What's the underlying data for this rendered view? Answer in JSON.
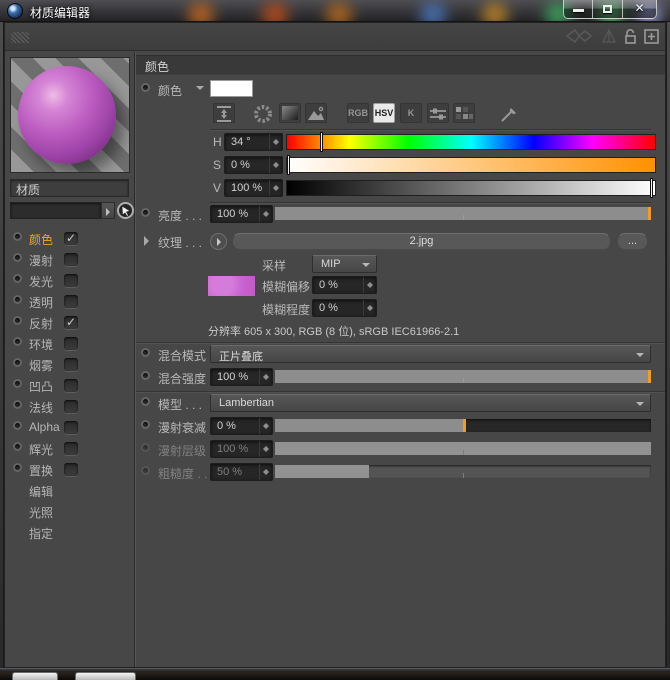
{
  "window": {
    "title": "材质编辑器"
  },
  "icons": {
    "close": "✕",
    "check": "✓",
    "plus": "+"
  },
  "sidebar": {
    "material_name": "材质",
    "channels": [
      {
        "label": "颜色",
        "checked": true,
        "active": true
      },
      {
        "label": "漫射",
        "checked": false,
        "active": false
      },
      {
        "label": "发光",
        "checked": false,
        "active": false
      },
      {
        "label": "透明",
        "checked": false,
        "active": false
      },
      {
        "label": "反射",
        "checked": true,
        "active": false
      },
      {
        "label": "环境",
        "checked": false,
        "active": false
      },
      {
        "label": "烟雾",
        "checked": false,
        "active": false
      },
      {
        "label": "凹凸",
        "checked": false,
        "active": false
      },
      {
        "label": "法线",
        "checked": false,
        "active": false
      },
      {
        "label": "Alpha",
        "checked": false,
        "active": false
      },
      {
        "label": "辉光",
        "checked": false,
        "active": false
      },
      {
        "label": "置换",
        "checked": false,
        "active": false
      }
    ],
    "extras": [
      {
        "label": "编辑"
      },
      {
        "label": "光照"
      },
      {
        "label": "指定"
      }
    ]
  },
  "main": {
    "header": "颜色",
    "color_label": "颜色",
    "color_value_hex": "#FFFFFF",
    "mode_rgb": "RGB",
    "mode_hsv": "HSV",
    "mode_k": "K",
    "h_label": "H",
    "h_value": "34 °",
    "s_label": "S",
    "s_value": "0 %",
    "v_label": "V",
    "v_value": "100 %",
    "brightness_label": "亮度 . . .",
    "brightness_value": "100 %",
    "texture_label": "纹理 . . .",
    "texture_file": "2.jpg",
    "texture_browse": "...",
    "sampling_label": "采样",
    "sampling_value": "MIP",
    "blur_offset_label": "模糊偏移",
    "blur_offset_value": "0 %",
    "blur_scale_label": "模糊程度",
    "blur_scale_value": "0 %",
    "resolution_info": "分辨率 605 x 300, RGB (8 位), sRGB IEC61966-2.1",
    "mix_mode_label": "混合模式",
    "mix_mode_value": "正片叠底",
    "mix_strength_label": "混合强度",
    "mix_strength_value": "100 %",
    "model_label": "模型 . . .",
    "model_value": "Lambertian",
    "falloff_label": "漫射衰减",
    "falloff_value": "0 %",
    "level_label": "漫射层级",
    "level_value": "100 %",
    "roughness_label": "粗糙度 . .",
    "roughness_value": "50 %"
  },
  "sliders": {
    "h_pos": 9.4,
    "s_pos": 0.6,
    "v_pos": 99.2,
    "brightness_fill": 100,
    "mix_strength_fill": 100,
    "falloff_fill": 50,
    "falloff_tick": 50,
    "level_fill": 100,
    "roughness_fill": 25
  },
  "colors": {
    "accent_orange": "#F59B1E",
    "panel_gray": "#474747",
    "texture_thumb_purple": "#C863CE",
    "sphere_purple": "#BB5CC0"
  }
}
